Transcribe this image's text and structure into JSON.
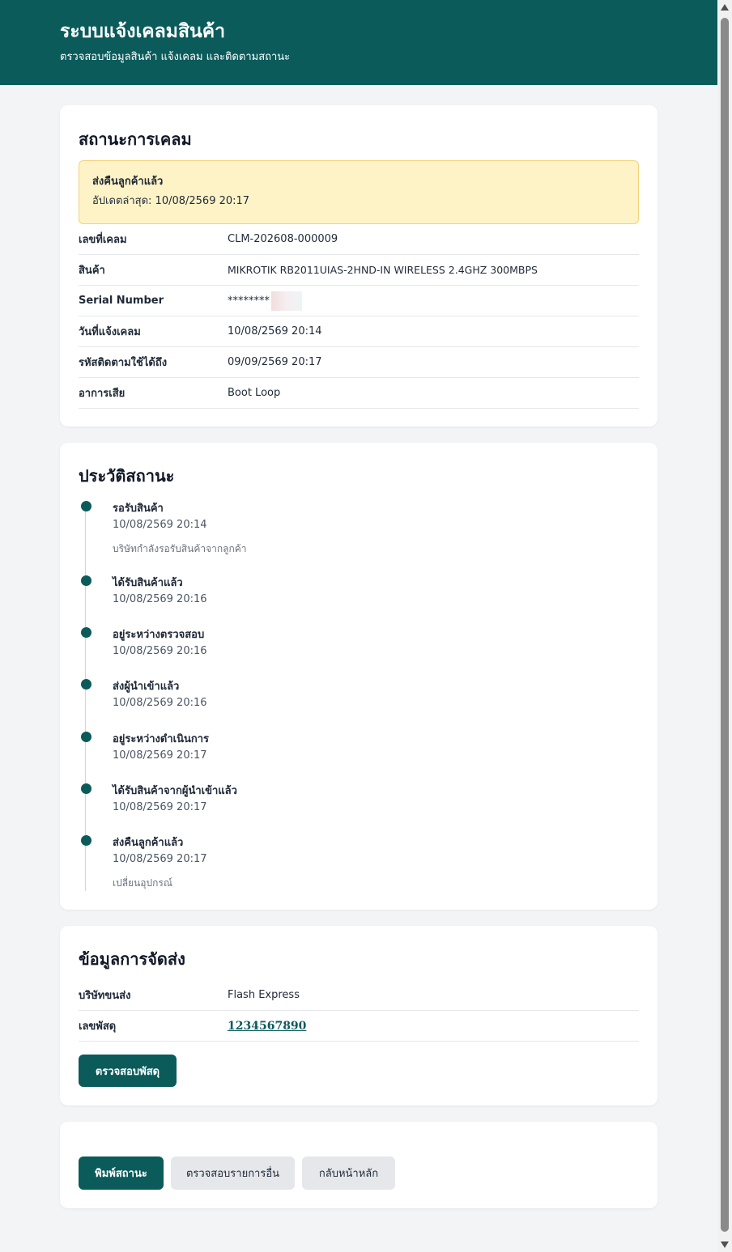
{
  "header": {
    "title": "ระบบแจ้งเคลมสินค้า",
    "subtitle": "ตรวจสอบข้อมูลสินค้า แจ้งเคลม และติดตามสถานะ"
  },
  "claim_status": {
    "title": "สถานะการเคลม",
    "current_status": "ส่งคืนลูกค้าแล้ว",
    "last_updated": "อัปเดตล่าสุด: 10/08/2569 20:17",
    "rows": [
      {
        "label": "เลขที่เคลม",
        "value": "CLM-202608-000009"
      },
      {
        "label": "สินค้า",
        "value": "MIKROTIK RB2011UIAS-2HND-IN WIRELESS 2.4GHZ 300MBPS"
      },
      {
        "label": "Serial Number",
        "value": "********"
      },
      {
        "label": "วันที่แจ้งเคลม",
        "value": "10/08/2569 20:14"
      },
      {
        "label": "รหัสติดตามใช้ได้ถึง",
        "value": "09/09/2569 20:17"
      },
      {
        "label": "อาการเสีย",
        "value": "Boot Loop"
      }
    ]
  },
  "history": {
    "title": "ประวัติสถานะ",
    "items": [
      {
        "title": "รอรับสินค้า",
        "time": "10/08/2569 20:14",
        "note": "บริษัทกำลังรอรับสินค้าจากลูกค้า"
      },
      {
        "title": "ได้รับสินค้าแล้ว",
        "time": "10/08/2569 20:16",
        "note": ""
      },
      {
        "title": "อยู่ระหว่างตรวจสอบ",
        "time": "10/08/2569 20:16",
        "note": ""
      },
      {
        "title": "ส่งผู้นำเข้าแล้ว",
        "time": "10/08/2569 20:16",
        "note": ""
      },
      {
        "title": "อยู่ระหว่างดำเนินการ",
        "time": "10/08/2569 20:17",
        "note": ""
      },
      {
        "title": "ได้รับสินค้าจากผู้นำเข้าแล้ว",
        "time": "10/08/2569 20:17",
        "note": ""
      },
      {
        "title": "ส่งคืนลูกค้าแล้ว",
        "time": "10/08/2569 20:17",
        "note": "เปลี่ยนอุปกรณ์"
      }
    ]
  },
  "shipping": {
    "title": "ข้อมูลการจัดส่ง",
    "carrier_label": "บริษัทขนส่ง",
    "carrier_value": "Flash Express",
    "tracking_label": "เลขพัสดุ",
    "tracking_value": "1234567890",
    "track_button": "ตรวจสอบพัสดุ"
  },
  "actions": {
    "print_button": "พิมพ์สถานะ",
    "check_other_button": "ตรวจสอบรายการอื่น",
    "home_button": "กลับหน้าหลัก"
  },
  "colors": {
    "brand": "#0b5b5b",
    "status_bg": "#fef3c7"
  }
}
